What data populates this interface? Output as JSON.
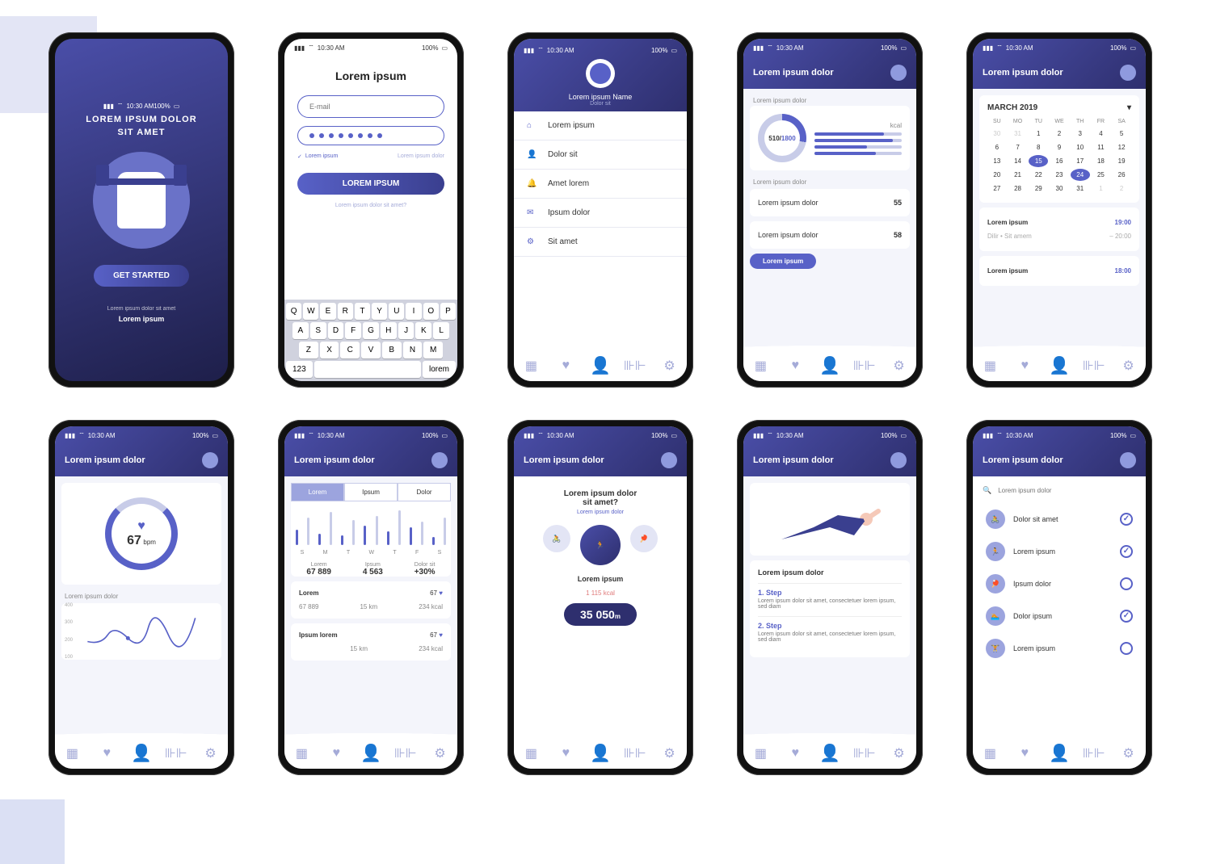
{
  "status": {
    "time": "10:30 AM",
    "battery": "100%"
  },
  "s1": {
    "title1": "LOREM IPSUM DOLOR",
    "title2": "SIT AMET",
    "cta": "GET STARTED",
    "foot1": "Lorem ipsum dolor sit amet",
    "foot2": "Lorem ipsum"
  },
  "s2": {
    "title": "Lorem ipsum",
    "email_ph": "E-mail",
    "remember": "Lorem ipsum",
    "forgot": "Lorem ipsum dolor",
    "submit": "LOREM IPSUM",
    "signup": "Lorem ipsum dolor sit amet?",
    "kb": {
      "r1": [
        "Q",
        "W",
        "E",
        "R",
        "T",
        "Y",
        "U",
        "I",
        "O",
        "P"
      ],
      "r2": [
        "A",
        "S",
        "D",
        "F",
        "G",
        "H",
        "J",
        "K",
        "L"
      ],
      "r3": [
        "Z",
        "X",
        "C",
        "V",
        "B",
        "N",
        "M"
      ],
      "num": "123",
      "enter": "lorem"
    }
  },
  "s3": {
    "name": "Lorem ipsum Name",
    "sub": "Dolor sit",
    "items": [
      "Lorem ipsum",
      "Dolor sit",
      "Amet lorem",
      "Ipsum dolor",
      "Sit amet"
    ]
  },
  "s4": {
    "header": "Lorem ipsum dolor",
    "card_title": "Lorem ipsum dolor",
    "kcal_cur": "510",
    "kcal_sep": "/",
    "kcal_max": "1800",
    "kcal_label": "kcal",
    "section": "Lorem ipsum dolor",
    "row1_l": "Lorem ipsum dolor",
    "row1_v": "55",
    "row2_l": "Lorem ipsum dolor",
    "row2_v": "58",
    "btn": "Lorem ipsum"
  },
  "s5": {
    "header": "Lorem ipsum dolor",
    "month": "MARCH  2019",
    "days": [
      "SU",
      "MO",
      "TU",
      "WE",
      "TH",
      "FR",
      "SA"
    ],
    "weeks": [
      [
        "30",
        "31",
        "1",
        "2",
        "3",
        "4",
        "5"
      ],
      [
        "6",
        "7",
        "8",
        "9",
        "10",
        "11",
        "12"
      ],
      [
        "13",
        "14",
        "15",
        "16",
        "17",
        "18",
        "19"
      ],
      [
        "20",
        "21",
        "22",
        "23",
        "24",
        "25",
        "26"
      ],
      [
        "27",
        "28",
        "29",
        "30",
        "31",
        "1",
        "2"
      ]
    ],
    "selected": [
      "15",
      "24"
    ],
    "ev1_t": "Lorem ipsum",
    "ev1_v": "19:00",
    "ev1_s": "Dilir  •  Sit amem",
    "ev1_s2": "– 20:00",
    "ev2_t": "Lorem ipsum",
    "ev2_v": "18:00"
  },
  "s6": {
    "header": "Lorem ipsum dolor",
    "bpm_v": "67",
    "bpm_u": "bpm",
    "section": "Lorem ipsum dolor",
    "yticks": [
      "400",
      "300",
      "200",
      "100"
    ]
  },
  "s7": {
    "header": "Lorem ipsum dolor",
    "tabs": [
      "Lorem",
      "Ipsum",
      "Dolor"
    ],
    "daylabels": [
      "S",
      "M",
      "T",
      "W",
      "T",
      "F",
      "S"
    ],
    "m1_l": "Lorem",
    "m1_v": "67 889",
    "m2_l": "Ipsum",
    "m2_v": "4 563",
    "m3_l": "Dolor sit",
    "m3_v": "+30%",
    "a1_l": "Lorem",
    "a1_v": "67",
    "a1_d": "67 889",
    "a1_km": "15 km",
    "a1_kcal": "234 kcal",
    "a2_l": "Ipsum lorem",
    "a2_v": "67",
    "a2_km": "15 km",
    "a2_kcal": "234 kcal"
  },
  "s8": {
    "header": "Lorem ipsum dolor",
    "q1": "Lorem ipsum dolor",
    "q2": "sit amet?",
    "q3": "Lorem ipsum dolor",
    "label": "Lorem ipsum",
    "kcal": "1 115 kcal",
    "val": "35 050",
    "unit": "m"
  },
  "s9": {
    "header": "Lorem ipsum dolor",
    "title": "Lorem ipsum dolor",
    "s1t": "1. Step",
    "s1d": "Lorem ipsum dolor sit amet, consectetuer lorem ipsum, sed diam",
    "s2t": "2. Step",
    "s2d": "Lorem ipsum dolor sit amet, consectetuer lorem ipsum, sed diam"
  },
  "s10": {
    "header": "Lorem ipsum dolor",
    "search_ph": "Lorem ipsum dolor",
    "items": [
      {
        "label": "Dolor sit amet",
        "checked": true
      },
      {
        "label": "Lorem ipsum",
        "checked": true
      },
      {
        "label": "Ipsum dolor",
        "checked": false
      },
      {
        "label": "Dolor ipsum",
        "checked": true
      },
      {
        "label": "Lorem ipsum",
        "checked": false
      }
    ]
  },
  "colors": {
    "primary": "#5861c7",
    "dark": "#2e2f6e"
  }
}
